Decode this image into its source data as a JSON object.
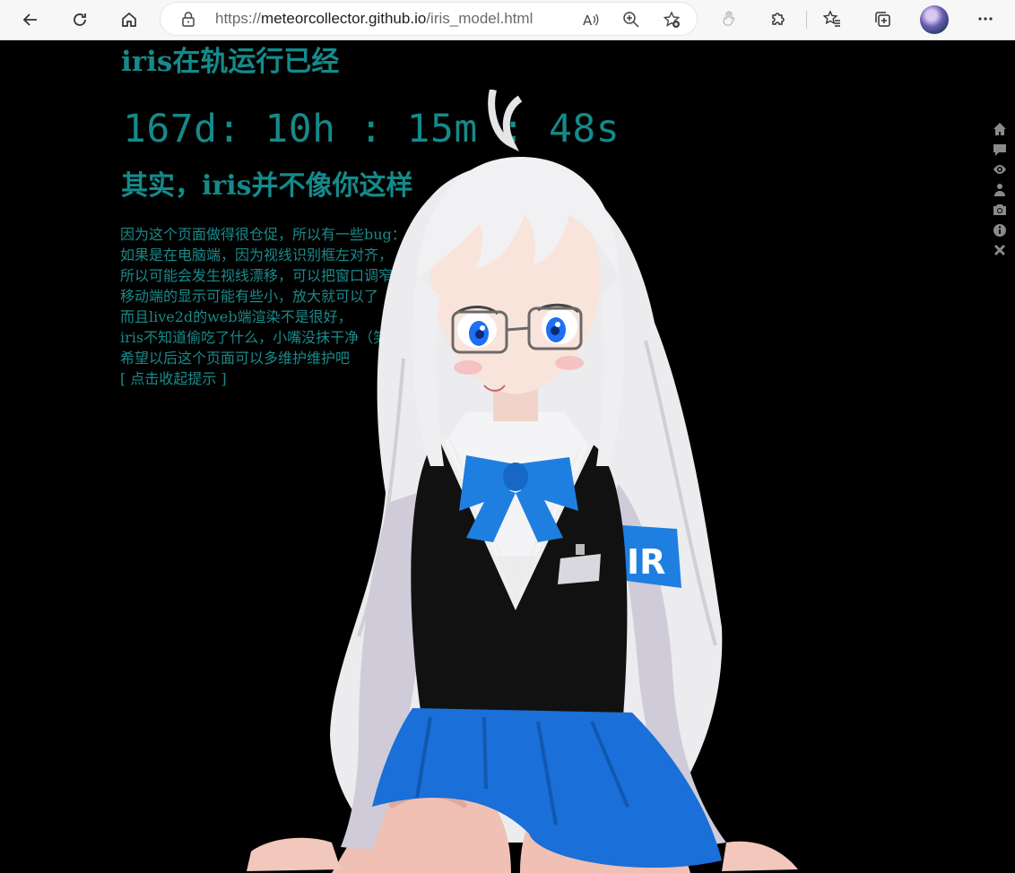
{
  "browser": {
    "url_prefix": "https://",
    "url_host": "meteorcollector.github.io",
    "url_path": "/iris_model.html"
  },
  "page": {
    "heading": "iris在轨运行已经",
    "timer": "167d: 10h : 15m : 48s",
    "subheading": "其实，iris并不像你这样",
    "notes": [
      "因为这个页面做得很仓促，所以有一些bug：",
      "如果是在电脑端，因为视线识别框左对齐，",
      "所以可能会发生视线漂移，可以把窗口调窄一点",
      "移动端的显示可能有些小，放大就可以了",
      "而且live2d的web端渲染不是很好，",
      "iris不知道偷吃了什么，小嘴没抹干净（笑",
      "希望以后这个页面可以多维护维护吧"
    ],
    "collapse_link": "[ 点击收起提示 ]"
  },
  "character": {
    "armband_text": "IR"
  },
  "toolbar_icons": [
    "home-icon",
    "chat-icon",
    "eye-icon",
    "person-icon",
    "camera-icon",
    "info-icon",
    "close-icon"
  ],
  "colors": {
    "accent_text": "#158a8a",
    "background": "#000000",
    "bow": "#1e7fe0",
    "skirt": "#1a6fd8"
  }
}
